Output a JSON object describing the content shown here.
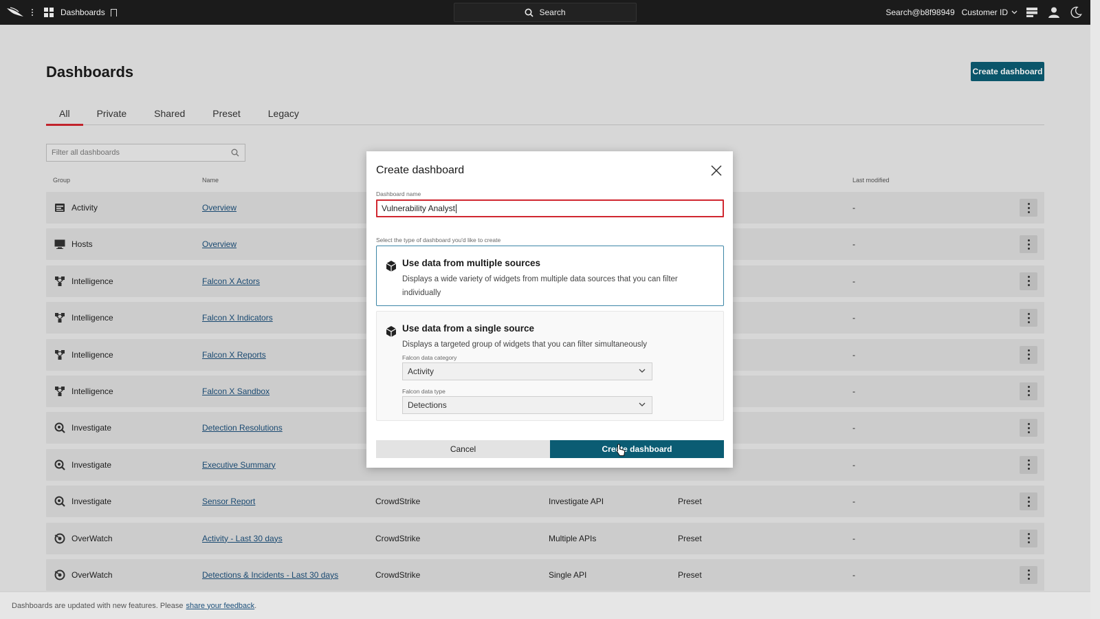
{
  "topbar": {
    "app_title": "Dashboards",
    "search_label": "Search",
    "user": "Search@b8f98949",
    "customer_id": "Customer ID"
  },
  "page": {
    "title": "Dashboards",
    "create_button": "Create dashboard"
  },
  "tabs": [
    {
      "label": "All",
      "active": true
    },
    {
      "label": "Private"
    },
    {
      "label": "Shared"
    },
    {
      "label": "Preset"
    },
    {
      "label": "Legacy"
    }
  ],
  "filter": {
    "placeholder": "Filter all dashboards"
  },
  "table": {
    "headers": {
      "group": "Group",
      "name": "Name",
      "last_modified": "Last modified"
    },
    "rows": [
      {
        "group": "Activity",
        "icon": "activity-icon",
        "name": "Overview",
        "source": "",
        "api": "",
        "type": "",
        "modified": "-"
      },
      {
        "group": "Hosts",
        "icon": "monitor-icon",
        "name": "Overview",
        "source": "",
        "api": "",
        "type": "",
        "modified": "-"
      },
      {
        "group": "Intelligence",
        "icon": "network-icon",
        "name": "Falcon X Actors",
        "source": "",
        "api": "",
        "type": "",
        "modified": "-"
      },
      {
        "group": "Intelligence",
        "icon": "network-icon",
        "name": "Falcon X Indicators",
        "source": "",
        "api": "",
        "type": "",
        "modified": "-"
      },
      {
        "group": "Intelligence",
        "icon": "network-icon",
        "name": "Falcon X Reports",
        "source": "",
        "api": "",
        "type": "",
        "modified": "-"
      },
      {
        "group": "Intelligence",
        "icon": "network-icon",
        "name": "Falcon X Sandbox",
        "source": "",
        "api": "",
        "type": "",
        "modified": "-"
      },
      {
        "group": "Investigate",
        "icon": "magnifier-icon",
        "name": "Detection Resolutions",
        "source": "",
        "api": "",
        "type": "",
        "modified": "-"
      },
      {
        "group": "Investigate",
        "icon": "magnifier-icon",
        "name": "Executive Summary",
        "source": "",
        "api": "",
        "type": "",
        "modified": "-"
      },
      {
        "group": "Investigate",
        "icon": "magnifier-icon",
        "name": "Sensor Report",
        "source": "CrowdStrike",
        "api": "Investigate API",
        "type": "Preset",
        "modified": "-"
      },
      {
        "group": "OverWatch",
        "icon": "overwatch-icon",
        "name": "Activity - Last 30 days",
        "source": "CrowdStrike",
        "api": "Multiple APIs",
        "type": "Preset",
        "modified": "-"
      },
      {
        "group": "OverWatch",
        "icon": "overwatch-icon",
        "name": "Detections & Incidents - Last 30 days",
        "source": "CrowdStrike",
        "api": "Single API",
        "type": "Preset",
        "modified": "-"
      }
    ]
  },
  "footer": {
    "text": "Dashboards are updated with new features. Please",
    "link": "share your feedback",
    "suffix": "."
  },
  "modal": {
    "title": "Create dashboard",
    "name_label": "Dashboard name",
    "name_value": "Vulnerability Analyst",
    "type_prompt": "Select the type of dashboard you'd like to create",
    "option_multi": {
      "title": "Use data from multiple sources",
      "desc": "Displays a wide variety of widgets from multiple data sources that you can filter individually",
      "selected": true
    },
    "option_single": {
      "title": "Use data from a single source",
      "desc": "Displays a targeted group of widgets that you can filter simultaneously",
      "category_label": "Falcon data category",
      "category_value": "Activity",
      "type_label": "Falcon data type",
      "type_value": "Detections"
    },
    "cancel": "Cancel",
    "create": "Create dashboard"
  },
  "colors": {
    "topbar": "#1b1b1b",
    "primary": "#0b5c73",
    "accent_red": "#d0262f",
    "link": "#1b4f7a"
  }
}
